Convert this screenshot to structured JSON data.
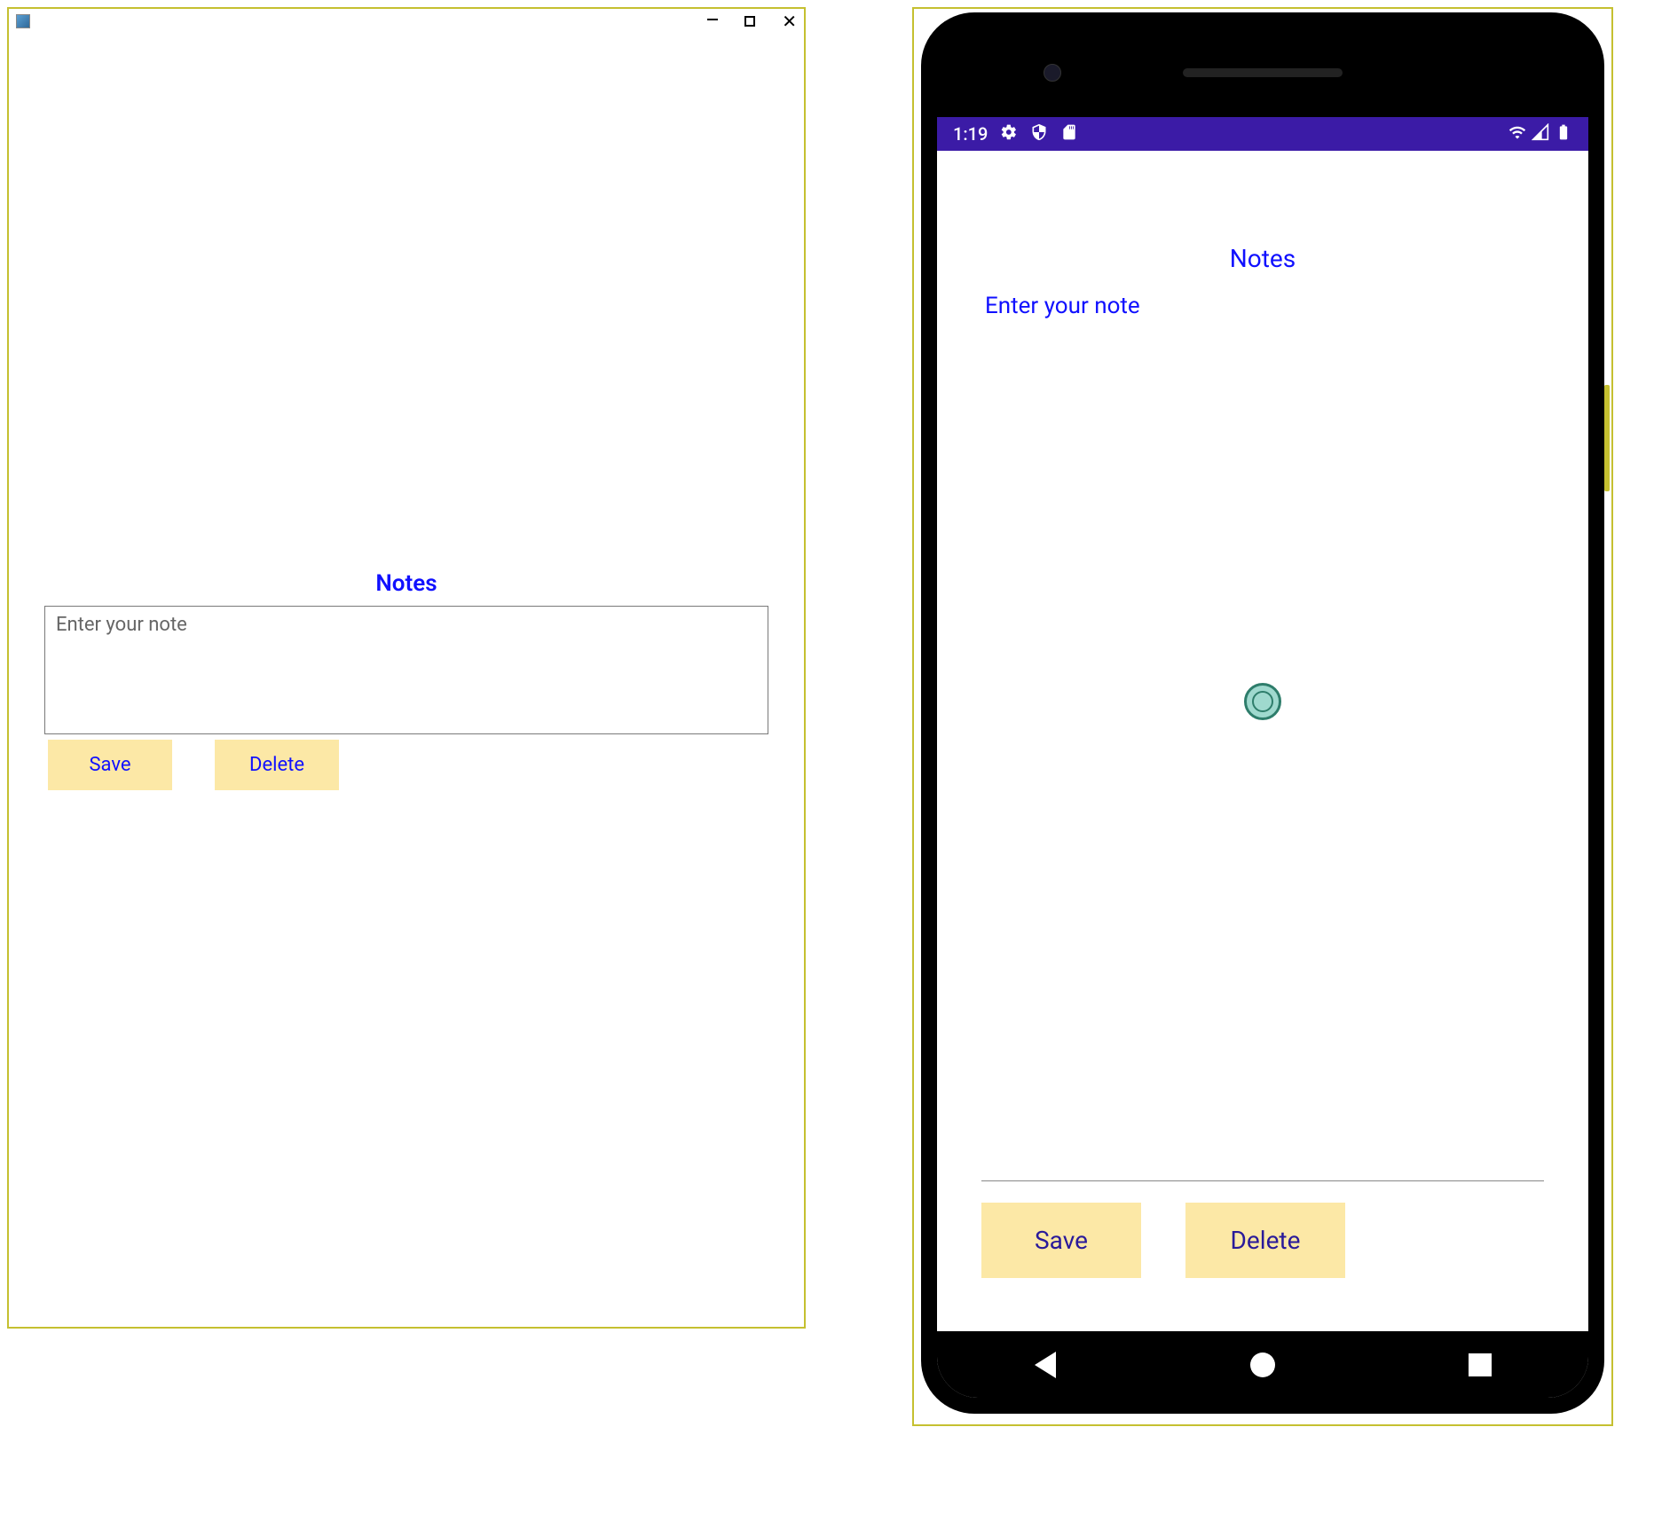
{
  "desktop": {
    "title": "Notes",
    "placeholder": "Enter your note",
    "buttons": {
      "save": "Save",
      "delete": "Delete"
    }
  },
  "phone": {
    "status": {
      "time": "1:19"
    },
    "title": "Notes",
    "placeholder": "Enter your note",
    "buttons": {
      "save": "Save",
      "delete": "Delete"
    }
  }
}
